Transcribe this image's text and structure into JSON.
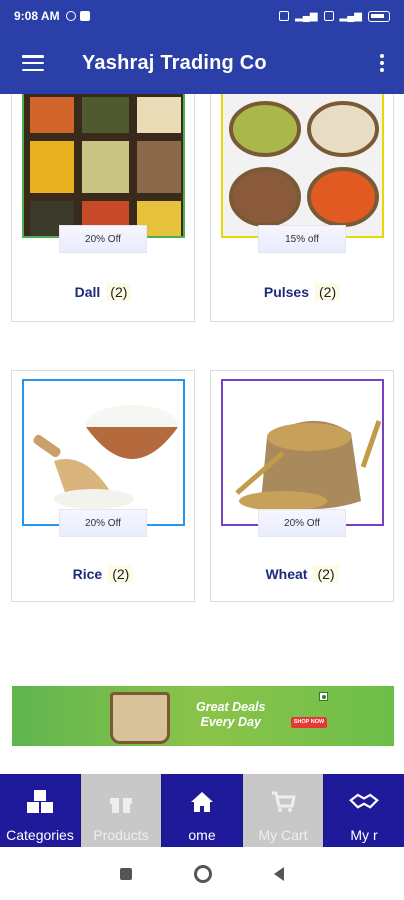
{
  "status_bar": {
    "time": "9:08 AM"
  },
  "app_bar": {
    "title": "Yashraj Trading Co"
  },
  "categories": [
    {
      "name": "Dall",
      "count": "(2)",
      "discount": "20% Off",
      "frame_color": "#4caf50"
    },
    {
      "name": "Pulses",
      "count": "(2)",
      "discount": "15% off",
      "frame_color": "#e6d800"
    },
    {
      "name": "Rice",
      "count": "(2)",
      "discount": "20% Off",
      "frame_color": "#2196f3"
    },
    {
      "name": "Wheat",
      "count": "(2)",
      "discount": "20% Off",
      "frame_color": "#7b3fc4"
    }
  ],
  "banner": {
    "line1": "Great Deals",
    "line2": "Every Day",
    "shop_label": "SHOP NOW"
  },
  "bottom_nav": [
    {
      "label": "Categories",
      "icon": "cubes-icon",
      "active": true
    },
    {
      "label": "Products",
      "icon": "gift-icon",
      "active": false
    },
    {
      "label": "ome",
      "icon": "home-icon",
      "active": true
    },
    {
      "label": "My Cart",
      "icon": "cart-icon",
      "active": false
    },
    {
      "label": "My   r",
      "icon": "handshake-icon",
      "active": true
    }
  ],
  "colors": {
    "primary": "#2b3fa8",
    "nav_bg": "#1f1a9a",
    "nav_inactive": "#c8c8c8"
  }
}
